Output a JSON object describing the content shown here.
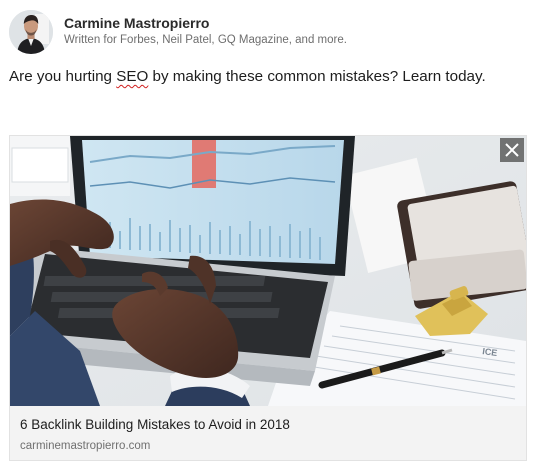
{
  "author": {
    "name": "Carmine Mastropierro",
    "headline": "Written for Forbes, Neil Patel, GQ Magazine, and more."
  },
  "commentary": {
    "before": "Are you hurting ",
    "flagged_word": "SEO",
    "after": " by making these common mistakes? Learn today."
  },
  "link_preview": {
    "title": "6 Backlink Building Mistakes to Avoid in 2018",
    "domain": "carminemastropierro.com",
    "image_icon": "laptop-typing-photo",
    "close_icon": "close-icon"
  },
  "colors": {
    "spellcheck_underline": "#d11f1f",
    "card_footer_bg": "#f3f3f3",
    "close_button_bg": "#585858"
  }
}
